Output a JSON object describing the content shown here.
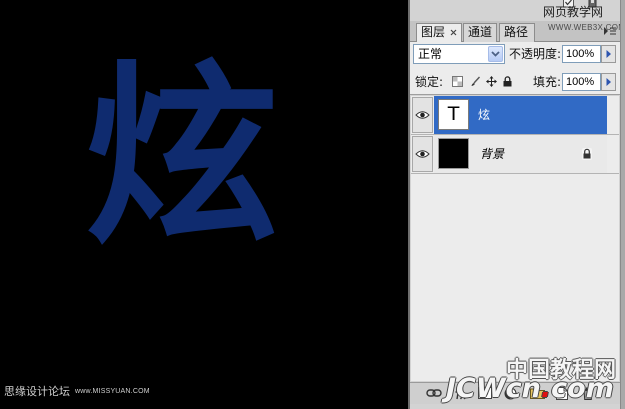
{
  "canvas": {
    "glyph": "炫",
    "glyph_color": "#0f2b6f",
    "background_color": "#000000"
  },
  "watermarks": {
    "missyuan_cn": "思缘设计论坛",
    "missyuan_url": "www.MISSYUAN.COM",
    "web3x_cn": "网页教学网",
    "web3x_url": "WWW.WEB3X.COM",
    "jcwcn_cn": "中国教程网",
    "jcwcn_name": "JCWcn",
    "jcwcn_dot": ".",
    "jcwcn_tld": "com",
    "jcwcn_dot_color": "#e01010"
  },
  "layers_panel": {
    "tabs": [
      {
        "label": "图层",
        "active": true,
        "close_icon": "close-icon"
      },
      {
        "label": "通道",
        "active": false
      },
      {
        "label": "路径",
        "active": false
      }
    ],
    "menu_icon": "panel-menu-icon",
    "blend_mode": {
      "value": "正常",
      "icon": "chevron-down-icon"
    },
    "opacity": {
      "label": "不透明度:",
      "value": "100%",
      "icon": "slider-arrow-icon"
    },
    "lock": {
      "label": "锁定:",
      "icons": [
        "lock-transparent-icon",
        "lock-image-icon",
        "lock-position-icon",
        "lock-all-icon"
      ]
    },
    "fill": {
      "label": "填充:",
      "value": "100%",
      "icon": "slider-arrow-icon"
    },
    "layers": [
      {
        "name": "炫",
        "thumbnail_text": "T",
        "visible": true,
        "selected": true,
        "visibility_icon": "eye-icon"
      },
      {
        "name": "背景",
        "visible": true,
        "selected": false,
        "locked": true,
        "thumbnail_color": "#000000",
        "visibility_icon": "eye-icon",
        "lock_icon": "lock-icon"
      }
    ],
    "footer_icons": [
      "link-icon",
      "fx-icon",
      "mask-icon",
      "adjustment-icon",
      "group-icon",
      "new-layer-icon",
      "trash-icon"
    ],
    "selection_color": "#316ac5"
  }
}
